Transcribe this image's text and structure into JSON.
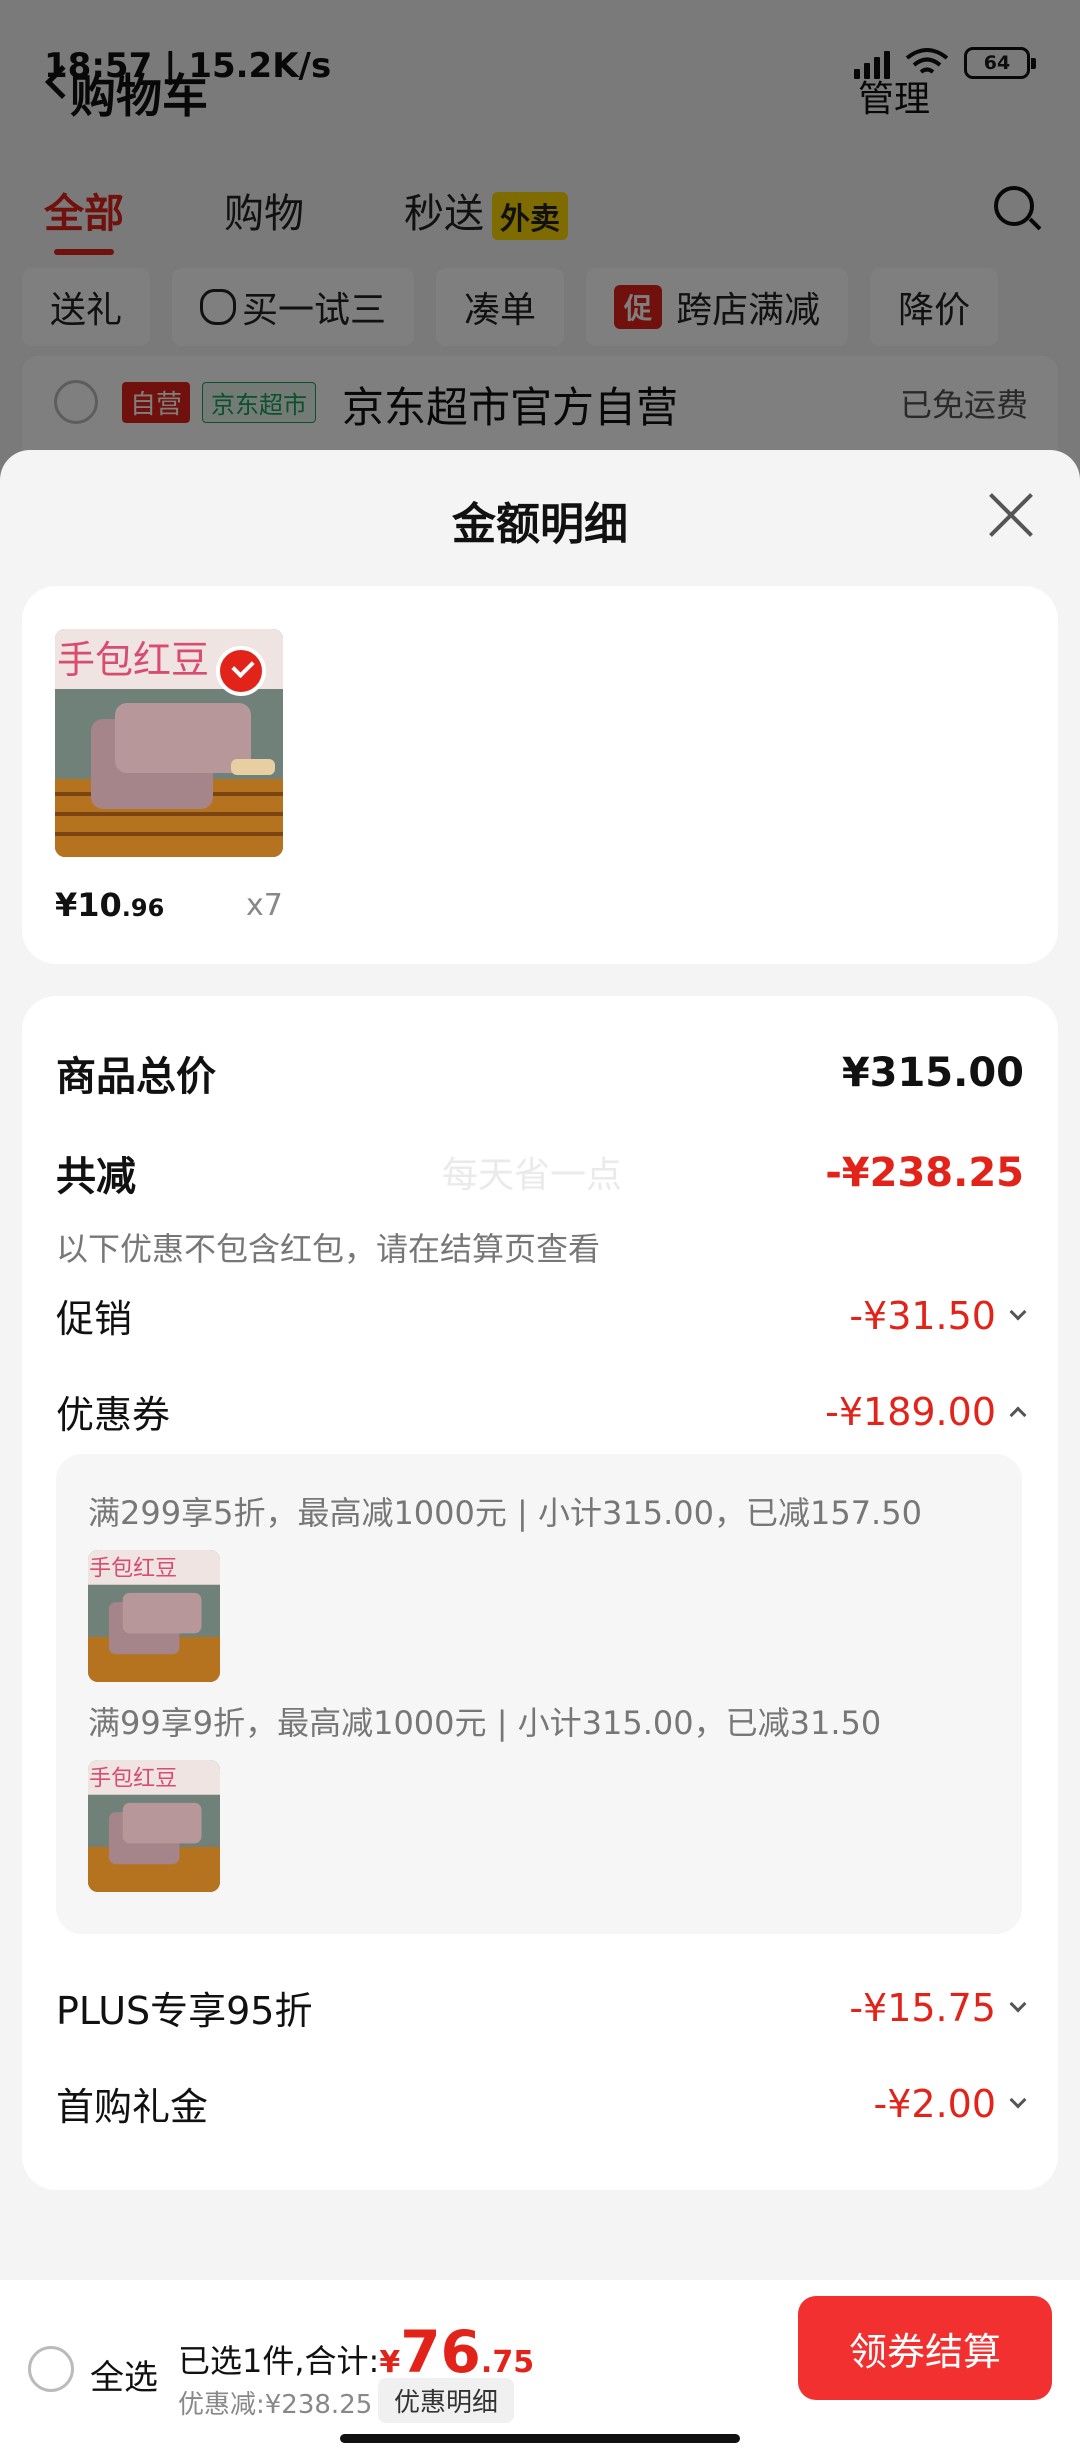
{
  "status_bar": {
    "time": "18:57 | 15.2K/s",
    "battery": "64",
    "icons": [
      "hd-signal-icon",
      "wifi-icon",
      "battery-icon"
    ]
  },
  "cart": {
    "title": "购物车",
    "manage": "管理",
    "tabs": [
      {
        "label": "全部",
        "active": true
      },
      {
        "label": "购物",
        "active": false
      },
      {
        "label": "秒送",
        "active": false,
        "tag": "外卖"
      }
    ],
    "chips": [
      "送礼",
      "买一试三",
      "凑单",
      "跨店满减",
      "降价"
    ],
    "chip_badge": "促",
    "store": {
      "tag_self": "自营",
      "tag_market": "京东超市",
      "name": "京东超市官方自营",
      "shipping": "已免运费"
    }
  },
  "sheet": {
    "title": "金额明细",
    "item": {
      "price_int": "¥10",
      "price_dec": ".96",
      "qty": "x7"
    },
    "rows": {
      "total_label": "商品总价",
      "total_value": "¥315.00",
      "reduce_label": "共减",
      "reduce_value": "-¥238.25",
      "note": "以下优惠不包含红包，请在结算页查看",
      "watermark": "每天省一点",
      "promo_label": "促销",
      "promo_value": "-¥31.50",
      "coupon_label": "优惠券",
      "coupon_value": "-¥189.00",
      "plus_label": "PLUS专享95折",
      "plus_value": "-¥15.75",
      "first_label": "首购礼金",
      "first_value": "-¥2.00"
    },
    "coupons": [
      {
        "text": "满299享5折，最高减1000元 | 小计315.00，已减157.50"
      },
      {
        "text": "满99享9折，最高减1000元 | 小计315.00，已减31.50"
      }
    ]
  },
  "bottom_bar": {
    "select_all": "全选",
    "selected_prefix": "已选1件,合计:",
    "currency": "¥",
    "total_int": "76",
    "total_dec": ".75",
    "discount": "优惠减:¥238.25",
    "detail_button": "优惠明细",
    "checkout_button": "领券结算"
  },
  "colors": {
    "accent": "#e2231a",
    "checkout": "#f23030",
    "sheet_bg": "#f4f4f4"
  }
}
